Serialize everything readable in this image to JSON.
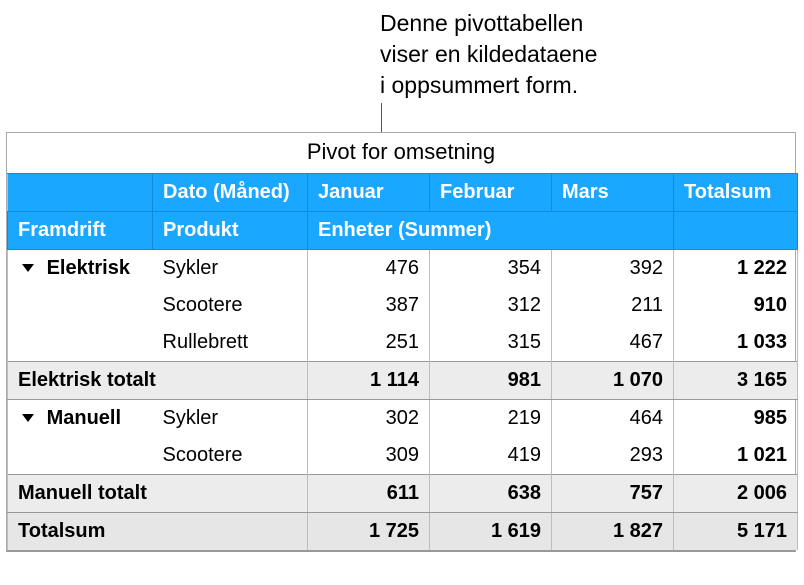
{
  "caption": {
    "line1": "Denne pivottabellen",
    "line2": "viser en kildedataene",
    "line3": "i oppsummert form."
  },
  "table": {
    "title": "Pivot for omsetning",
    "header1": {
      "blank": "",
      "date_month": "Dato (Måned)",
      "months": [
        "Januar",
        "Februar",
        "Mars"
      ],
      "totalsum": "Totalsum"
    },
    "header2": {
      "framdrift": "Framdrift",
      "produkt": "Produkt",
      "enheter_summer": "Enheter (Summer)",
      "blank": ""
    },
    "groups": [
      {
        "name": "Elektrisk",
        "rows": [
          {
            "product": "Sykler",
            "m": [
              "476",
              "354",
              "392"
            ],
            "total": "1 222"
          },
          {
            "product": "Scootere",
            "m": [
              "387",
              "312",
              "211"
            ],
            "total": "910"
          },
          {
            "product": "Rullebrett",
            "m": [
              "251",
              "315",
              "467"
            ],
            "total": "1 033"
          }
        ],
        "subtotal_label": "Elektrisk totalt",
        "subtotal": {
          "m": [
            "1 114",
            "981",
            "1 070"
          ],
          "total": "3 165"
        }
      },
      {
        "name": "Manuell",
        "rows": [
          {
            "product": "Sykler",
            "m": [
              "302",
              "219",
              "464"
            ],
            "total": "985"
          },
          {
            "product": "Scootere",
            "m": [
              "309",
              "419",
              "293"
            ],
            "total": "1 021"
          }
        ],
        "subtotal_label": "Manuell totalt",
        "subtotal": {
          "m": [
            "611",
            "638",
            "757"
          ],
          "total": "2 006"
        }
      }
    ],
    "grand": {
      "label": "Totalsum",
      "m": [
        "1 725",
        "1 619",
        "1 827"
      ],
      "total": "5 171"
    }
  }
}
